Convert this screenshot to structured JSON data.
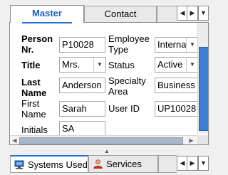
{
  "top_tabs": [
    {
      "label": "Master",
      "active": true
    },
    {
      "label": "Contact",
      "active": false
    }
  ],
  "form": {
    "person_nr": {
      "label_line1": "Person",
      "label_line2": "Nr.",
      "value": "P10028"
    },
    "title": {
      "label": "Title",
      "value": "Mrs."
    },
    "last_name": {
      "label_line1": "Last",
      "label_line2": "Name",
      "value": "Anderson"
    },
    "first_name": {
      "label_line1": "First",
      "label_line2": "Name",
      "value": "Sarah"
    },
    "initials": {
      "label": "Initials",
      "value": "SA"
    },
    "employee_type": {
      "label_line1": "Employee",
      "label_line2": "Type",
      "value": "Interna"
    },
    "status": {
      "label": "Status",
      "value": "Active"
    },
    "specialty_area": {
      "label_line1": "Specialty",
      "label_line2": "Area",
      "value": "Business"
    },
    "user_id": {
      "label": "User ID",
      "value": "UP10028"
    }
  },
  "bottom_tabs": [
    {
      "label": "Systems Used",
      "icon": "computer-icon",
      "active": true
    },
    {
      "label": "Services",
      "icon": "person-icon",
      "active": false
    }
  ],
  "colors": {
    "accent": "#2b6fd6",
    "active_tab_text": "#1f5fc4",
    "scroll_thumb": "#3a7ed6"
  }
}
